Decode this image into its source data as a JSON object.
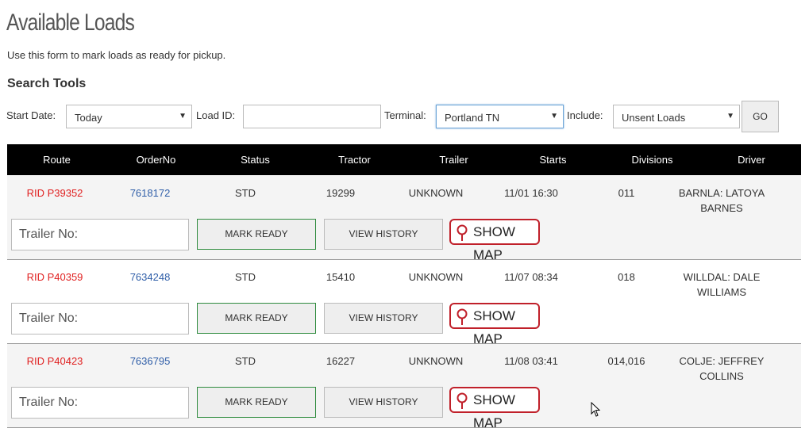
{
  "page": {
    "title": "Available Loads",
    "subtitle": "Use this form to mark loads as ready for pickup.",
    "section_title": "Search Tools"
  },
  "search": {
    "start_date_label": "Start Date:",
    "start_date_value": "Today",
    "load_id_label": "Load ID:",
    "load_id_value": "",
    "terminal_label": "Terminal:",
    "terminal_value": "Portland TN",
    "include_label": "Include:",
    "include_value": "Unsent Loads",
    "go_label": "GO"
  },
  "table": {
    "headers": [
      "Route",
      "OrderNo",
      "Status",
      "Tractor",
      "Trailer",
      "Starts",
      "Divisions",
      "Driver"
    ],
    "rows": [
      {
        "route": "RID P39352",
        "order": "7618172",
        "status": "STD",
        "tractor": "19299",
        "trailer": "UNKNOWN",
        "starts": "11/01 16:30",
        "divisions": "011",
        "driver": "BARNLA: LATOYA BARNES"
      },
      {
        "route": "RID P40359",
        "order": "7634248",
        "status": "STD",
        "tractor": "15410",
        "trailer": "UNKNOWN",
        "starts": "11/07 08:34",
        "divisions": "018",
        "driver": "WILLDAL: DALE WILLIAMS"
      },
      {
        "route": "RID P40423",
        "order": "7636795",
        "status": "STD",
        "tractor": "16227",
        "trailer": "UNKNOWN",
        "starts": "11/08 03:41",
        "divisions": "014,016",
        "driver": "COLJE: JEFFREY COLLINS"
      }
    ]
  },
  "actions": {
    "trailer_placeholder": "Trailer No:",
    "mark_ready": "MARK READY",
    "view_history": "VIEW HISTORY",
    "show_map": "SHOW MAP"
  },
  "colors": {
    "route_red": "#e02020",
    "order_blue": "#2f5ea8",
    "map_border": "#c0202a",
    "mark_border": "#2e8b3d"
  }
}
